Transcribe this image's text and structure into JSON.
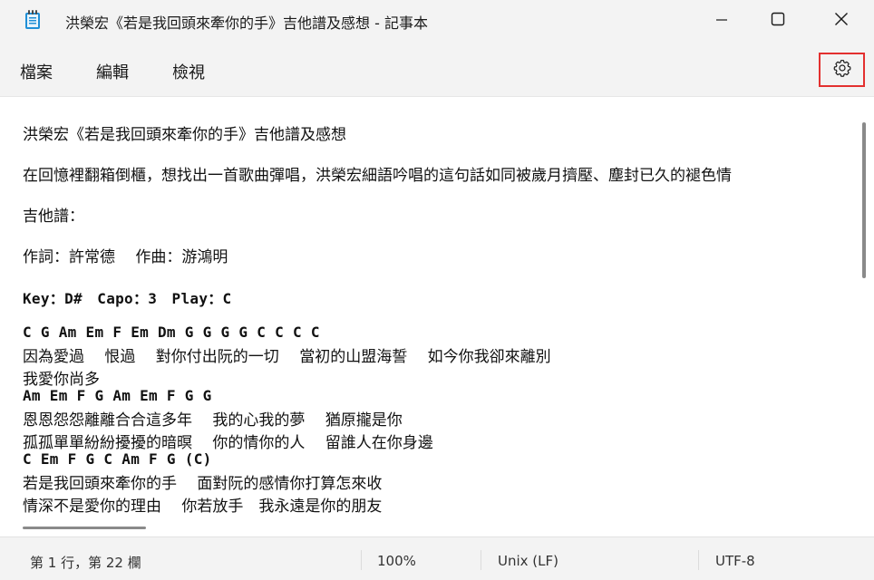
{
  "window": {
    "title": "洪榮宏《若是我回頭來牽你的手》吉他譜及感想 - 記事本"
  },
  "menu": {
    "file": "檔案",
    "edit": "編輯",
    "view": "檢視"
  },
  "editor": {
    "lines": [
      "洪榮宏《若是我回頭來牽你的手》吉他譜及感想",
      "在回憶裡翻箱倒櫃，想找出一首歌曲彈唱，洪榮宏細語吟唱的這句話如同被歲月擠壓、塵封已久的褪色情",
      "吉他譜：",
      "作詞：許常德　 作曲：游鴻明",
      "Key：D#　Capo：3　Play：C",
      "C G Am Em F Em Dm G G G G C C C C",
      "因為愛過　 恨過　 對你付出阮的一切　 當初的山盟海誓　 如今你我卻來離別",
      "我愛你尚多",
      "Am Em F G Am Em F G G",
      "恩恩怨怨離離合合這多年　 我的心我的夢　 猶原攏是你",
      "孤孤單單紛紛擾擾的暗暝　 你的情你的人　 留誰人在你身邊",
      "C Em F G C Am F G (C)",
      "若是我回頭來牽你的手　 面對阮的感情你打算怎來收",
      "情深不是愛你的理由　 你若放手　我永遠是你的朋友"
    ]
  },
  "status": {
    "position": "第 1 行，第 22 欄",
    "zoom": "100%",
    "line_ending": "Unix (LF)",
    "encoding": "UTF-8"
  },
  "colors": {
    "highlight_border": "#e3302f",
    "app_icon": "#1f8fd6"
  },
  "icons": {
    "app": "notepad-icon",
    "minimize": "minimize-icon",
    "maximize": "maximize-icon",
    "close": "close-icon",
    "settings": "gear-icon"
  }
}
